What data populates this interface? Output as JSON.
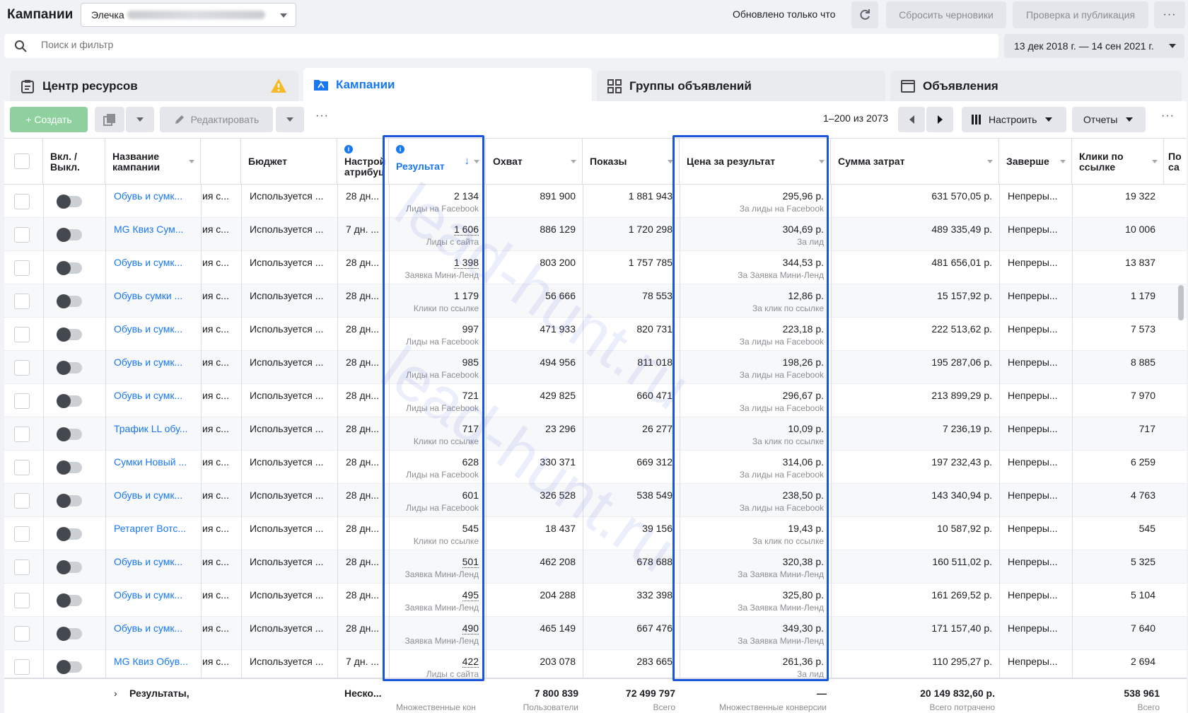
{
  "header": {
    "title": "Кампании",
    "account_name": "Элечка",
    "updated_text": "Обновлено только что",
    "reset_drafts": "Сбросить черновики",
    "review_publish": "Проверка и публикация",
    "more": "···"
  },
  "search": {
    "placeholder": "Поиск и фильтр",
    "date_range": "13 дек 2018 г. — 14 сен 2021 г."
  },
  "tabs": [
    {
      "label": "Центр ресурсов",
      "icon": "clipboard-icon"
    },
    {
      "label": "Кампании",
      "icon": "folder-icon",
      "active": true
    },
    {
      "label": "Группы объявлений",
      "icon": "grid-icon"
    },
    {
      "label": "Объявления",
      "icon": "ad-icon"
    }
  ],
  "toolbar": {
    "create": "+ Создать",
    "edit": "Редактировать",
    "more": "···",
    "pagination": "1–200 из 2073",
    "setup": "Настроить",
    "reports": "Отчеты",
    "more_right": "···"
  },
  "columns": {
    "onoff": "Вкл. / Выкл.",
    "name": "Название кампании",
    "budget": "Бюджет",
    "attribution": "Настрой атрибуц",
    "result": "Результат",
    "reach": "Охват",
    "impressions": "Показы",
    "cost_per_result": "Цена за результат",
    "spend": "Сумма затрат",
    "ends": "Заверше",
    "link_clicks": "Клики по ссылке",
    "extra": "По са"
  },
  "rows": [
    {
      "name": "Обувь и сумк...",
      "delivery": "ия с...",
      "budget": "Используется ...",
      "attr": "28 дн...",
      "result": "2 134",
      "result_type": "Лиды на Facebook",
      "result_dotted": false,
      "reach": "891 900",
      "impr": "1 881 943",
      "cpr": "295,96 р.",
      "cpr_type": "За лиды на Facebook",
      "spend": "631 570,05 р.",
      "ends": "Непреры...",
      "clicks": "19 322"
    },
    {
      "name": "MG Квиз Сум...",
      "delivery": "ия с...",
      "budget": "Используется ...",
      "attr": "7 дн. ...",
      "result": "1 606",
      "result_type": "Лиды с сайта",
      "result_dotted": true,
      "reach": "886 129",
      "impr": "1 720 298",
      "cpr": "304,69 р.",
      "cpr_type": "За лид",
      "spend": "489 335,49 р.",
      "ends": "Непреры...",
      "clicks": "10 006"
    },
    {
      "name": "Обувь и сумк...",
      "delivery": "ия с...",
      "budget": "Используется ...",
      "attr": "28 дн...",
      "result": "1 398",
      "result_type": "Заявка Мини-Ленд",
      "result_dotted": true,
      "reach": "803 200",
      "impr": "1 757 785",
      "cpr": "344,53 р.",
      "cpr_type": "За Заявка Мини-Ленд",
      "spend": "481 656,01 р.",
      "ends": "Непреры...",
      "clicks": "13 837"
    },
    {
      "name": "Обувь сумки ...",
      "delivery": "ия с...",
      "budget": "Используется ...",
      "attr": "28 дн...",
      "result": "1 179",
      "result_type": "Клики по ссылке",
      "result_dotted": false,
      "reach": "56 666",
      "impr": "78 553",
      "cpr": "12,86 р.",
      "cpr_type": "За клик по ссылке",
      "spend": "15 157,92 р.",
      "ends": "Непреры...",
      "clicks": "1 179"
    },
    {
      "name": "Обувь и сумк...",
      "delivery": "ия с...",
      "budget": "Используется ...",
      "attr": "28 дн...",
      "result": "997",
      "result_type": "Лиды на Facebook",
      "result_dotted": false,
      "reach": "471 933",
      "impr": "820 731",
      "cpr": "223,18 р.",
      "cpr_type": "За лиды на Facebook",
      "spend": "222 513,62 р.",
      "ends": "Непреры...",
      "clicks": "7 573"
    },
    {
      "name": "Обувь и сумк...",
      "delivery": "ия с...",
      "budget": "Используется ...",
      "attr": "28 дн...",
      "result": "985",
      "result_type": "Лиды на Facebook",
      "result_dotted": false,
      "reach": "494 956",
      "impr": "811 018",
      "cpr": "198,26 р.",
      "cpr_type": "За лиды на Facebook",
      "spend": "195 287,06 р.",
      "ends": "Непреры...",
      "clicks": "8 885"
    },
    {
      "name": "Обувь и сумк...",
      "delivery": "ия с...",
      "budget": "Используется ...",
      "attr": "28 дн...",
      "result": "721",
      "result_type": "Лиды на Facebook",
      "result_dotted": false,
      "reach": "429 825",
      "impr": "660 471",
      "cpr": "296,67 р.",
      "cpr_type": "За лиды на Facebook",
      "spend": "213 899,29 р.",
      "ends": "Непреры...",
      "clicks": "7 970"
    },
    {
      "name": "Трафик LL обу...",
      "delivery": "ия с...",
      "budget": "Используется ...",
      "attr": "28 дн...",
      "result": "717",
      "result_type": "Клики по ссылке",
      "result_dotted": false,
      "reach": "23 296",
      "impr": "26 277",
      "cpr": "10,09 р.",
      "cpr_type": "За клик по ссылке",
      "spend": "7 236,19 р.",
      "ends": "Непреры...",
      "clicks": "717"
    },
    {
      "name": "Сумки Новый ...",
      "delivery": "ия с...",
      "budget": "Используется ...",
      "attr": "28 дн...",
      "result": "628",
      "result_type": "Лиды на Facebook",
      "result_dotted": false,
      "reach": "330 371",
      "impr": "669 312",
      "cpr": "314,06 р.",
      "cpr_type": "За лиды на Facebook",
      "spend": "197 232,43 р.",
      "ends": "Непреры...",
      "clicks": "6 259"
    },
    {
      "name": "Обувь и сумк...",
      "delivery": "ия с...",
      "budget": "Используется ...",
      "attr": "28 дн...",
      "result": "601",
      "result_type": "Лиды на Facebook",
      "result_dotted": false,
      "reach": "326 528",
      "impr": "538 549",
      "cpr": "238,50 р.",
      "cpr_type": "За лиды на Facebook",
      "spend": "143 340,94 р.",
      "ends": "Непреры...",
      "clicks": "4 763"
    },
    {
      "name": "Ретаргет Вотс...",
      "delivery": "ия с...",
      "budget": "Используется ...",
      "attr": "28 дн...",
      "result": "545",
      "result_type": "Клики по ссылке",
      "result_dotted": false,
      "reach": "18 437",
      "impr": "39 156",
      "cpr": "19,43 р.",
      "cpr_type": "За клик по ссылке",
      "spend": "10 587,92 р.",
      "ends": "Непреры...",
      "clicks": "545"
    },
    {
      "name": "Обувь и сумк...",
      "delivery": "ия с...",
      "budget": "Используется ...",
      "attr": "28 дн...",
      "result": "501",
      "result_type": "Заявка Мини-Ленд",
      "result_dotted": true,
      "reach": "462 208",
      "impr": "678 688",
      "cpr": "320,38 р.",
      "cpr_type": "За Заявка Мини-Ленд",
      "spend": "160 511,02 р.",
      "ends": "Непреры...",
      "clicks": "5 325"
    },
    {
      "name": "Обувь и сумк...",
      "delivery": "ия с...",
      "budget": "Используется ...",
      "attr": "28 дн...",
      "result": "495",
      "result_type": "Заявка Мини-Ленд",
      "result_dotted": true,
      "reach": "204 288",
      "impr": "332 398",
      "cpr": "325,80 р.",
      "cpr_type": "За Заявка Мини-Ленд",
      "spend": "161 269,52 р.",
      "ends": "Непреры...",
      "clicks": "5 104"
    },
    {
      "name": "Обувь и сумк...",
      "delivery": "ия с...",
      "budget": "Используется ...",
      "attr": "28 дн...",
      "result": "490",
      "result_type": "Заявка Мини-Ленд",
      "result_dotted": true,
      "reach": "465 149",
      "impr": "667 476",
      "cpr": "349,30 р.",
      "cpr_type": "За Заявка Мини-Ленд",
      "spend": "171 157,40 р.",
      "ends": "Непреры...",
      "clicks": "7 640"
    },
    {
      "name": "MG Квиз Обув...",
      "delivery": "ия с...",
      "budget": "Используется ...",
      "attr": "7 дн. ...",
      "result": "422",
      "result_type": "Лиды с сайта",
      "result_dotted": true,
      "reach": "203 078",
      "impr": "283 665",
      "cpr": "261,36 р.",
      "cpr_type": "За лид",
      "spend": "110 295,27 р.",
      "ends": "Непреры...",
      "clicks": "2 694"
    }
  ],
  "totals": {
    "label": "Результаты,",
    "attr": "Неско...",
    "result_sub": "Множественные кон",
    "reach": "7 800 839",
    "reach_sub": "Пользователи",
    "impr": "72 499 797",
    "impr_sub": "Всего",
    "cpr": "—",
    "cpr_sub": "Множественные конверсии",
    "spend": "20 149 832,60 р.",
    "spend_sub": "Всего потрачено",
    "clicks": "538 961",
    "clicks_sub": "Всего"
  },
  "watermark": "lead-hunt.ru",
  "colors": {
    "accent": "#1877f2",
    "highlight_box": "#1a56db",
    "create_btn": "#8fd19e"
  }
}
